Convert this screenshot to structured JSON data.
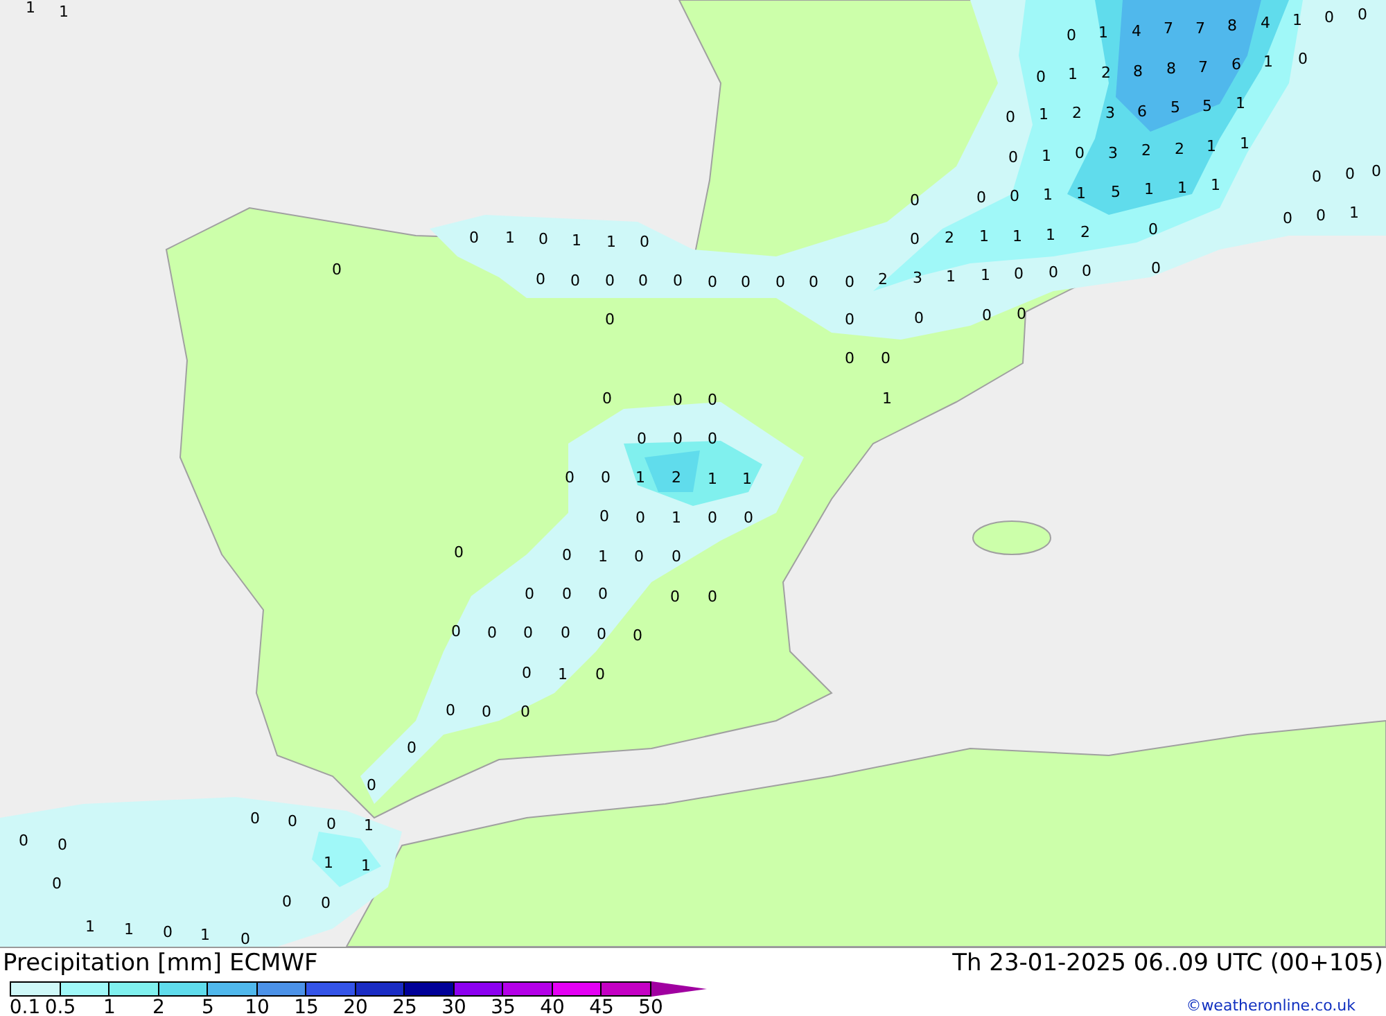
{
  "map": {
    "labels": [
      "1",
      "1",
      "0",
      "1",
      "4",
      "7",
      "7",
      "8",
      "4",
      "1",
      "0",
      "0",
      "0",
      "1",
      "2",
      "8",
      "8",
      "7",
      "6",
      "1",
      "0",
      "0",
      "1",
      "2",
      "3",
      "6",
      "5",
      "5",
      "1",
      "0",
      "1",
      "0",
      "3",
      "2",
      "2",
      "1",
      "1",
      "0",
      "0",
      "0",
      "1",
      "1",
      "5",
      "1",
      "1",
      "1",
      "0",
      "0",
      "0",
      "0",
      "2",
      "1",
      "1",
      "1",
      "2",
      "0",
      "0",
      "0",
      "1",
      "0",
      "1",
      "0",
      "1",
      "1",
      "0",
      "0",
      "0",
      "0",
      "0",
      "0",
      "0",
      "0",
      "0",
      "0",
      "0",
      "0",
      "2",
      "3",
      "1",
      "1",
      "0",
      "0",
      "0",
      "0",
      "0",
      "0",
      "0",
      "0",
      "0",
      "0",
      "0",
      "0",
      "0",
      "0",
      "1",
      "0",
      "0",
      "0",
      "0",
      "0",
      "1",
      "2",
      "1",
      "1",
      "0",
      "0",
      "1",
      "0",
      "0",
      "0",
      "0",
      "1",
      "0",
      "0",
      "0",
      "0",
      "0",
      "0",
      "0",
      "0",
      "0",
      "0",
      "0",
      "0",
      "0",
      "0",
      "1",
      "0",
      "0",
      "0",
      "0",
      "0",
      "0",
      "0",
      "0",
      "0",
      "1",
      "0",
      "0",
      "0",
      "1",
      "1",
      "0",
      "0",
      "1",
      "1",
      "0",
      "1",
      "0"
    ]
  },
  "legend": {
    "title": "Precipitation [mm] ECMWF",
    "valid_time": "Th 23-01-2025 06..09 UTC (00+105)",
    "scale": [
      {
        "label": "0.1",
        "color": "#cff8f8"
      },
      {
        "label": "0.5",
        "color": "#a0f8f8"
      },
      {
        "label": "1",
        "color": "#80f0ee"
      },
      {
        "label": "2",
        "color": "#60dcec"
      },
      {
        "label": "5",
        "color": "#50b8ec"
      },
      {
        "label": "10",
        "color": "#4c92e8"
      },
      {
        "label": "15",
        "color": "#3454e8"
      },
      {
        "label": "20",
        "color": "#1a2cc4"
      },
      {
        "label": "25",
        "color": "#000098"
      },
      {
        "label": "30",
        "color": "#8c00f0"
      },
      {
        "label": "35",
        "color": "#b400e8"
      },
      {
        "label": "40",
        "color": "#e400f4"
      },
      {
        "label": "45",
        "color": "#c400c4"
      },
      {
        "label": "50",
        "color": "#a000a0"
      }
    ],
    "credit": "©weatheronline.co.uk"
  }
}
